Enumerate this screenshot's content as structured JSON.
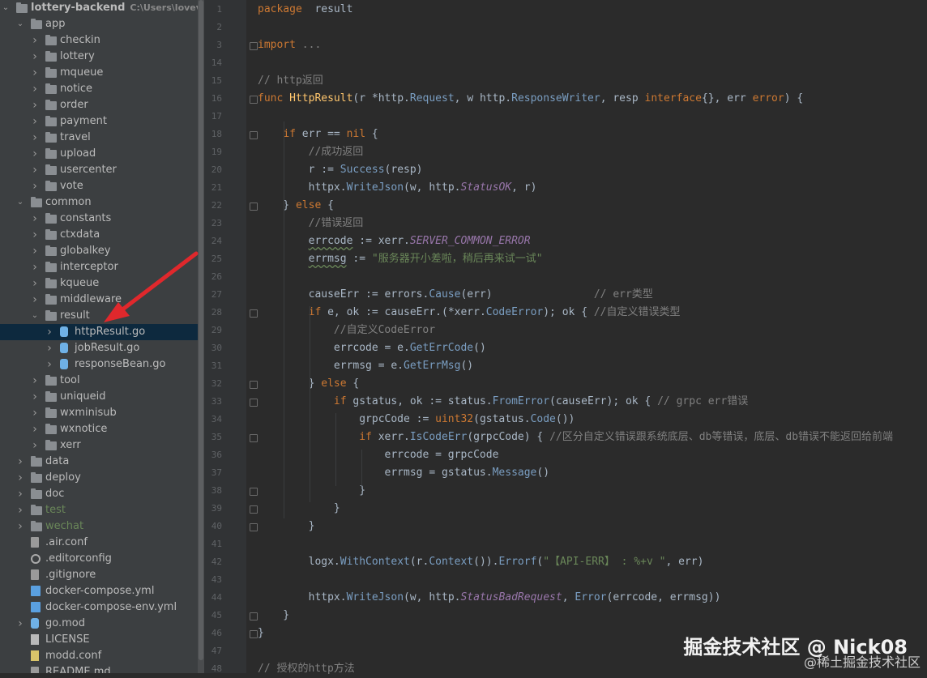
{
  "project": {
    "title": "lottery-backend",
    "path": "C:\\Users\\lovevivi\\De"
  },
  "tree": [
    {
      "label": "lottery-backend",
      "depth": 0,
      "arrow": "down",
      "icon": "folder-icon",
      "kind": "folder",
      "with_path": true
    },
    {
      "label": "app",
      "depth": 1,
      "arrow": "down",
      "icon": "folder-icon",
      "kind": "folder"
    },
    {
      "label": "checkin",
      "depth": 2,
      "arrow": "right",
      "icon": "folder-icon",
      "kind": "folder"
    },
    {
      "label": "lottery",
      "depth": 2,
      "arrow": "right",
      "icon": "folder-icon",
      "kind": "folder"
    },
    {
      "label": "mqueue",
      "depth": 2,
      "arrow": "right",
      "icon": "folder-icon",
      "kind": "folder"
    },
    {
      "label": "notice",
      "depth": 2,
      "arrow": "right",
      "icon": "folder-icon",
      "kind": "folder"
    },
    {
      "label": "order",
      "depth": 2,
      "arrow": "right",
      "icon": "folder-icon",
      "kind": "folder"
    },
    {
      "label": "payment",
      "depth": 2,
      "arrow": "right",
      "icon": "folder-icon",
      "kind": "folder"
    },
    {
      "label": "travel",
      "depth": 2,
      "arrow": "right",
      "icon": "folder-icon",
      "kind": "folder"
    },
    {
      "label": "upload",
      "depth": 2,
      "arrow": "right",
      "icon": "folder-icon",
      "kind": "folder"
    },
    {
      "label": "usercenter",
      "depth": 2,
      "arrow": "right",
      "icon": "folder-icon",
      "kind": "folder"
    },
    {
      "label": "vote",
      "depth": 2,
      "arrow": "right",
      "icon": "folder-icon",
      "kind": "folder"
    },
    {
      "label": "common",
      "depth": 1,
      "arrow": "down",
      "icon": "folder-icon",
      "kind": "folder"
    },
    {
      "label": "constants",
      "depth": 2,
      "arrow": "right",
      "icon": "folder-icon",
      "kind": "folder"
    },
    {
      "label": "ctxdata",
      "depth": 2,
      "arrow": "right",
      "icon": "folder-icon",
      "kind": "folder"
    },
    {
      "label": "globalkey",
      "depth": 2,
      "arrow": "right",
      "icon": "folder-icon",
      "kind": "folder"
    },
    {
      "label": "interceptor",
      "depth": 2,
      "arrow": "right",
      "icon": "folder-icon",
      "kind": "folder"
    },
    {
      "label": "kqueue",
      "depth": 2,
      "arrow": "right",
      "icon": "folder-icon",
      "kind": "folder"
    },
    {
      "label": "middleware",
      "depth": 2,
      "arrow": "right",
      "icon": "folder-icon",
      "kind": "folder"
    },
    {
      "label": "result",
      "depth": 2,
      "arrow": "down",
      "icon": "folder-icon",
      "kind": "folder"
    },
    {
      "label": "httpResult.go",
      "depth": 3,
      "arrow": "right",
      "icon": "go-file-icon",
      "kind": "go",
      "selected": true
    },
    {
      "label": "jobResult.go",
      "depth": 3,
      "arrow": "right",
      "icon": "go-file-icon",
      "kind": "go"
    },
    {
      "label": "responseBean.go",
      "depth": 3,
      "arrow": "right",
      "icon": "go-file-icon",
      "kind": "go"
    },
    {
      "label": "tool",
      "depth": 2,
      "arrow": "right",
      "icon": "folder-icon",
      "kind": "folder"
    },
    {
      "label": "uniqueid",
      "depth": 2,
      "arrow": "right",
      "icon": "folder-icon",
      "kind": "folder"
    },
    {
      "label": "wxminisub",
      "depth": 2,
      "arrow": "right",
      "icon": "folder-icon",
      "kind": "folder"
    },
    {
      "label": "wxnotice",
      "depth": 2,
      "arrow": "right",
      "icon": "folder-icon",
      "kind": "folder"
    },
    {
      "label": "xerr",
      "depth": 2,
      "arrow": "right",
      "icon": "folder-icon",
      "kind": "folder"
    },
    {
      "label": "data",
      "depth": 1,
      "arrow": "right",
      "icon": "folder-icon",
      "kind": "folder"
    },
    {
      "label": "deploy",
      "depth": 1,
      "arrow": "right",
      "icon": "folder-icon",
      "kind": "folder"
    },
    {
      "label": "doc",
      "depth": 1,
      "arrow": "right",
      "icon": "folder-icon",
      "kind": "folder"
    },
    {
      "label": "test",
      "depth": 1,
      "arrow": "right",
      "icon": "folder-icon",
      "kind": "folder",
      "green": true
    },
    {
      "label": "wechat",
      "depth": 1,
      "arrow": "right",
      "icon": "folder-icon",
      "kind": "folder",
      "green": true
    },
    {
      "label": ".air.conf",
      "depth": 1,
      "arrow": "",
      "icon": "file-icon",
      "kind": "file"
    },
    {
      "label": ".editorconfig",
      "depth": 1,
      "arrow": "",
      "icon": "gear-icon",
      "kind": "gear"
    },
    {
      "label": ".gitignore",
      "depth": 1,
      "arrow": "",
      "icon": "file-icon",
      "kind": "file"
    },
    {
      "label": "docker-compose.yml",
      "depth": 1,
      "arrow": "",
      "icon": "yaml-file-icon",
      "kind": "yml"
    },
    {
      "label": "docker-compose-env.yml",
      "depth": 1,
      "arrow": "",
      "icon": "yaml-file-icon",
      "kind": "yml"
    },
    {
      "label": "go.mod",
      "depth": 1,
      "arrow": "right",
      "icon": "go-mod-icon",
      "kind": "go"
    },
    {
      "label": "LICENSE",
      "depth": 1,
      "arrow": "",
      "icon": "license-file-icon",
      "kind": "lic"
    },
    {
      "label": "modd.conf",
      "depth": 1,
      "arrow": "",
      "icon": "config-file-icon",
      "kind": "conf"
    },
    {
      "label": "README.md",
      "depth": 1,
      "arrow": "",
      "icon": "markdown-file-icon",
      "kind": "file"
    }
  ],
  "editor": {
    "lines": [
      {
        "n": "1",
        "fold": false,
        "tokens": [
          [
            "kw",
            "package"
          ],
          [
            "",
            "  result"
          ]
        ]
      },
      {
        "n": "2",
        "tokens": []
      },
      {
        "n": "3",
        "fold": true,
        "tokens": [
          [
            "kw",
            "import"
          ],
          [
            "",
            " "
          ],
          [
            "cm",
            "..."
          ]
        ]
      },
      {
        "n": "14",
        "tokens": []
      },
      {
        "n": "15",
        "tokens": [
          [
            "cm",
            "// http返回"
          ]
        ]
      },
      {
        "n": "16",
        "fold": true,
        "tokens": [
          [
            "kw",
            "func"
          ],
          [
            "",
            " "
          ],
          [
            "fn",
            "HttpResult"
          ],
          [
            "",
            "(r *http."
          ],
          [
            "mth",
            "Request"
          ],
          [
            "",
            ", w http."
          ],
          [
            "mth",
            "ResponseWriter"
          ],
          [
            "",
            ", resp "
          ],
          [
            "kw",
            "interface"
          ],
          [
            "",
            "{}, err "
          ],
          [
            "kw",
            "error"
          ],
          [
            "",
            ") {"
          ]
        ]
      },
      {
        "n": "17",
        "tokens": []
      },
      {
        "n": "18",
        "fold": true,
        "tokens": [
          [
            "",
            "    "
          ],
          [
            "kw",
            "if"
          ],
          [
            "",
            " err == "
          ],
          [
            "kw",
            "nil"
          ],
          [
            "",
            " {"
          ]
        ]
      },
      {
        "n": "19",
        "tokens": [
          [
            "",
            "        "
          ],
          [
            "cm",
            "//成功返回"
          ]
        ]
      },
      {
        "n": "20",
        "tokens": [
          [
            "",
            "        r := "
          ],
          [
            "mth",
            "Success"
          ],
          [
            "",
            "(resp)"
          ]
        ]
      },
      {
        "n": "21",
        "tokens": [
          [
            "",
            "        httpx."
          ],
          [
            "mth",
            "WriteJson"
          ],
          [
            "",
            "(w, http."
          ],
          [
            "ty",
            "StatusOK"
          ],
          [
            "",
            ", r)"
          ]
        ]
      },
      {
        "n": "22",
        "fold": true,
        "tokens": [
          [
            "",
            "    } "
          ],
          [
            "kw",
            "else"
          ],
          [
            "",
            " {"
          ]
        ]
      },
      {
        "n": "23",
        "tokens": [
          [
            "",
            "        "
          ],
          [
            "cm",
            "//错误返回"
          ]
        ]
      },
      {
        "n": "24",
        "tokens": [
          [
            "",
            "        "
          ],
          [
            "sq",
            "errcode"
          ],
          [
            "",
            " := xerr."
          ],
          [
            "ty",
            "SERVER_COMMON_ERROR"
          ]
        ]
      },
      {
        "n": "25",
        "tokens": [
          [
            "",
            "        "
          ],
          [
            "sq",
            "errmsg"
          ],
          [
            "",
            " := "
          ],
          [
            "str",
            "\"服务器开小差啦，稍后再来试一试\""
          ]
        ]
      },
      {
        "n": "26",
        "tokens": []
      },
      {
        "n": "27",
        "tokens": [
          [
            "",
            "        causeErr := errors."
          ],
          [
            "mth",
            "Cause"
          ],
          [
            "",
            "(err)                "
          ],
          [
            "cm",
            "// err类型"
          ]
        ]
      },
      {
        "n": "28",
        "fold": true,
        "tokens": [
          [
            "",
            "        "
          ],
          [
            "kw",
            "if"
          ],
          [
            "",
            " e, ok := causeErr.(*xerr."
          ],
          [
            "mth",
            "CodeError"
          ],
          [
            "",
            "); ok { "
          ],
          [
            "cm",
            "//自定义错误类型"
          ]
        ]
      },
      {
        "n": "29",
        "tokens": [
          [
            "",
            "            "
          ],
          [
            "cm",
            "//自定义CodeError"
          ]
        ]
      },
      {
        "n": "30",
        "tokens": [
          [
            "",
            "            errcode = e."
          ],
          [
            "mth",
            "GetErrCode"
          ],
          [
            "",
            "()"
          ]
        ]
      },
      {
        "n": "31",
        "tokens": [
          [
            "",
            "            errmsg = e."
          ],
          [
            "mth",
            "GetErrMsg"
          ],
          [
            "",
            "()"
          ]
        ]
      },
      {
        "n": "32",
        "fold": true,
        "tokens": [
          [
            "",
            "        } "
          ],
          [
            "kw",
            "else"
          ],
          [
            "",
            " {"
          ]
        ]
      },
      {
        "n": "33",
        "fold": true,
        "tokens": [
          [
            "",
            "            "
          ],
          [
            "kw",
            "if"
          ],
          [
            "",
            " gstatus, ok := status."
          ],
          [
            "mth",
            "FromError"
          ],
          [
            "",
            "(causeErr); ok { "
          ],
          [
            "cm",
            "// grpc err错误"
          ]
        ]
      },
      {
        "n": "34",
        "tokens": [
          [
            "",
            "                grpcCode := "
          ],
          [
            "kw",
            "uint32"
          ],
          [
            "",
            "(gstatus."
          ],
          [
            "mth",
            "Code"
          ],
          [
            "",
            "())"
          ]
        ]
      },
      {
        "n": "35",
        "fold": true,
        "tokens": [
          [
            "",
            "                "
          ],
          [
            "kw",
            "if"
          ],
          [
            "",
            " xerr."
          ],
          [
            "mth",
            "IsCodeErr"
          ],
          [
            "",
            "(grpcCode) { "
          ],
          [
            "cm",
            "//区分自定义错误跟系统底层、db等错误，底层、db错误不能返回给前端"
          ]
        ]
      },
      {
        "n": "36",
        "tokens": [
          [
            "",
            "                    errcode = grpcCode"
          ]
        ]
      },
      {
        "n": "37",
        "tokens": [
          [
            "",
            "                    errmsg = gstatus."
          ],
          [
            "mth",
            "Message"
          ],
          [
            "",
            "()"
          ]
        ]
      },
      {
        "n": "38",
        "fold": true,
        "tokens": [
          [
            "",
            "                }"
          ]
        ]
      },
      {
        "n": "39",
        "fold": true,
        "tokens": [
          [
            "",
            "            }"
          ]
        ]
      },
      {
        "n": "40",
        "fold": true,
        "tokens": [
          [
            "",
            "        }"
          ]
        ]
      },
      {
        "n": "41",
        "tokens": []
      },
      {
        "n": "42",
        "tokens": [
          [
            "",
            "        logx."
          ],
          [
            "mth",
            "WithContext"
          ],
          [
            "",
            "(r."
          ],
          [
            "mth",
            "Context"
          ],
          [
            "",
            "())."
          ],
          [
            "mth",
            "Errorf"
          ],
          [
            "",
            "("
          ],
          [
            "str",
            "\"【API-ERR】 : %+v \""
          ],
          [
            "",
            ", err)"
          ]
        ]
      },
      {
        "n": "43",
        "tokens": []
      },
      {
        "n": "44",
        "tokens": [
          [
            "",
            "        httpx."
          ],
          [
            "mth",
            "WriteJson"
          ],
          [
            "",
            "(w, http."
          ],
          [
            "ty",
            "StatusBadRequest"
          ],
          [
            "",
            ", "
          ],
          [
            "mth",
            "Error"
          ],
          [
            "",
            "(errcode, errmsg))"
          ]
        ]
      },
      {
        "n": "45",
        "fold": true,
        "tokens": [
          [
            "",
            "    }"
          ]
        ]
      },
      {
        "n": "46",
        "fold": true,
        "tokens": [
          [
            "",
            "}"
          ]
        ]
      },
      {
        "n": "47",
        "tokens": []
      },
      {
        "n": "48",
        "tokens": [
          [
            "cm",
            "// 授权的http方法"
          ]
        ]
      }
    ]
  },
  "watermark": {
    "main": "掘金技术社区 @ Nick08",
    "sub": "@稀土掘金技术社区"
  },
  "colors": {
    "arrow": "#e0282c",
    "selection": "#0d293e"
  }
}
